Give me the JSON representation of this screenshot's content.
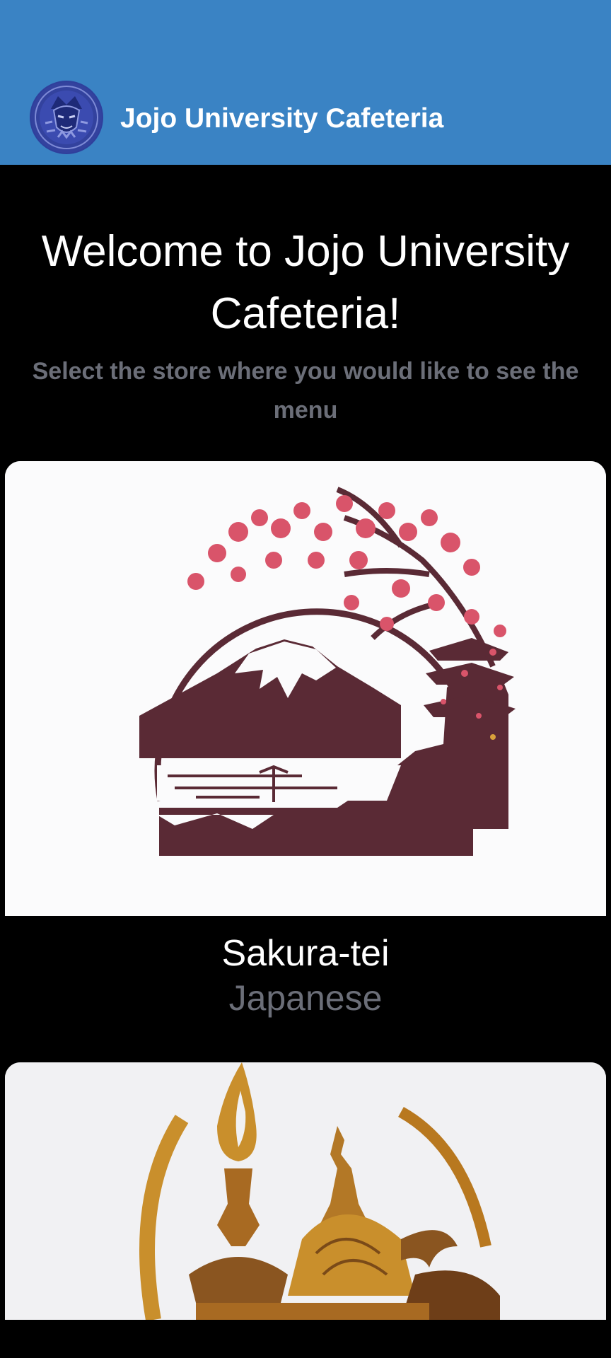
{
  "app_bar": {
    "title": "Jojo University Cafeteria",
    "background_color": "#3a83c4",
    "logo_icon": "samurai-mask-emblem-icon"
  },
  "welcome": {
    "heading_line1": "Welcome to Jojo University",
    "heading_line2": "Cafeteria!",
    "subtitle_line1": "Select the store where you would like to see the",
    "subtitle_line2": "menu"
  },
  "stores": [
    {
      "name": "Sakura-tei",
      "cuisine": "Japanese",
      "image_icon": "mount-fuji-cherry-blossom-pagoda-icon"
    },
    {
      "image_icon": "golden-temple-flame-icon"
    }
  ],
  "colors": {
    "background": "#000000",
    "muted_text": "#6b6e78",
    "fuji_maroon": "#5a2a35",
    "blossom_pink": "#d9546a",
    "gold": "#c98f2c"
  }
}
